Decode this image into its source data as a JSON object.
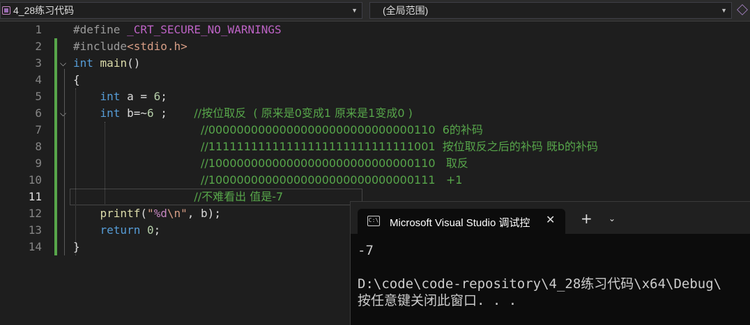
{
  "navbar": {
    "file_dropdown": "4_28练习代码",
    "scope_dropdown": "(全局范围)"
  },
  "editor": {
    "line_numbers": [
      "1",
      "2",
      "3",
      "4",
      "5",
      "6",
      "7",
      "8",
      "9",
      "10",
      "11",
      "12",
      "13",
      "14"
    ],
    "current_line": 11,
    "lines": [
      [
        {
          "t": "#define ",
          "c": "pp"
        },
        {
          "t": "_CRT_SECURE_NO_WARNINGS",
          "c": "macro"
        }
      ],
      [
        {
          "t": "#include",
          "c": "pp"
        },
        {
          "t": "<stdio.h>",
          "c": "str"
        }
      ],
      [
        {
          "t": "int",
          "c": "kw"
        },
        {
          "t": " ",
          "c": ""
        },
        {
          "t": "main",
          "c": "fn"
        },
        {
          "t": "()",
          "c": ""
        }
      ],
      [
        {
          "t": "{",
          "c": ""
        }
      ],
      [
        {
          "t": "    ",
          "c": ""
        },
        {
          "t": "int",
          "c": "kw"
        },
        {
          "t": " a = ",
          "c": ""
        },
        {
          "t": "6",
          "c": "num"
        },
        {
          "t": ";",
          "c": ""
        }
      ],
      [
        {
          "t": "    ",
          "c": ""
        },
        {
          "t": "int",
          "c": "kw"
        },
        {
          "t": " b=~",
          "c": ""
        },
        {
          "t": "6",
          "c": "num"
        },
        {
          "t": " ;    ",
          "c": ""
        },
        {
          "t": "//按位取反  ( 原来是0变成1 原来是1变成0 )",
          "c": "cmt"
        }
      ],
      [
        {
          "t": "                   ",
          "c": ""
        },
        {
          "t": "//00000000000000000000000000000110  6的补码",
          "c": "cmt"
        }
      ],
      [
        {
          "t": "                   ",
          "c": ""
        },
        {
          "t": "//11111111111111111111111111111001  按位取反之后的补码 既b的补码",
          "c": "cmt"
        }
      ],
      [
        {
          "t": "                   ",
          "c": ""
        },
        {
          "t": "//10000000000000000000000000000110   取反",
          "c": "cmt"
        }
      ],
      [
        {
          "t": "                   ",
          "c": ""
        },
        {
          "t": "//10000000000000000000000000000111   +1",
          "c": "cmt"
        }
      ],
      [
        {
          "t": "                  ",
          "c": ""
        },
        {
          "t": "//不难看出 值是-7",
          "c": "cmt"
        }
      ],
      [
        {
          "t": "    ",
          "c": ""
        },
        {
          "t": "printf",
          "c": "fn"
        },
        {
          "t": "(",
          "c": ""
        },
        {
          "t": "\"",
          "c": "str"
        },
        {
          "t": "%d",
          "c": "fmt"
        },
        {
          "t": "\\n\"",
          "c": "str"
        },
        {
          "t": ", b);",
          "c": ""
        }
      ],
      [
        {
          "t": "    ",
          "c": ""
        },
        {
          "t": "return",
          "c": "kw"
        },
        {
          "t": " ",
          "c": ""
        },
        {
          "t": "0",
          "c": "num"
        },
        {
          "t": ";",
          "c": ""
        }
      ],
      [
        {
          "t": "}",
          "c": ""
        }
      ]
    ]
  },
  "terminal": {
    "tab_title": "Microsoft Visual Studio 调试控",
    "icon_text": "C:\\",
    "close_glyph": "✕",
    "new_tab_glyph": "+",
    "dropdown_glyph": "⌄",
    "output": [
      "-7",
      "",
      "D:\\code\\code-repository\\4_28练习代码\\x64\\Debug\\",
      "按任意键关闭此窗口. . ."
    ]
  }
}
